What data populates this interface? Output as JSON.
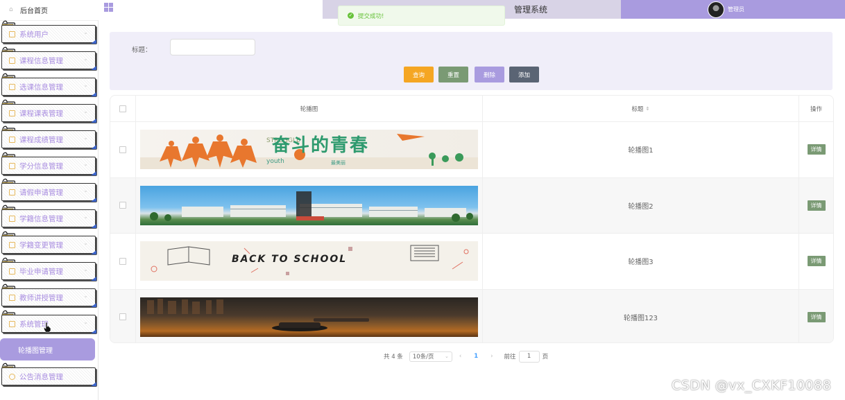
{
  "sidebar": {
    "home_label": "后台首页",
    "items": [
      {
        "label": "系统用户",
        "icon": "user-icon"
      },
      {
        "label": "课程信息管理",
        "icon": "doc-icon"
      },
      {
        "label": "选课信息管理",
        "icon": "doc-icon"
      },
      {
        "label": "课程课表管理",
        "icon": "doc-icon"
      },
      {
        "label": "课程成绩管理",
        "icon": "doc-icon"
      },
      {
        "label": "学分信息管理",
        "icon": "doc-icon"
      },
      {
        "label": "请假申请管理",
        "icon": "doc-icon"
      },
      {
        "label": "学籍信息管理",
        "icon": "doc-icon"
      },
      {
        "label": "学籍变更管理",
        "icon": "doc-icon"
      },
      {
        "label": "毕业申请管理",
        "icon": "doc-icon"
      },
      {
        "label": "教师讲授管理",
        "icon": "doc-icon"
      },
      {
        "label": "系统管理",
        "icon": "doc-icon"
      }
    ],
    "active_sub": "轮播图管理",
    "last_item": {
      "label": "公告消息管理",
      "icon": "info-icon"
    }
  },
  "header": {
    "title": "管理系统",
    "user": "管理员"
  },
  "toast": {
    "message": "提交成功!"
  },
  "search": {
    "label": "标题：",
    "value": "",
    "buttons": {
      "query": "查询",
      "reset": "重置",
      "delete": "删除",
      "add": "添加"
    }
  },
  "table": {
    "headers": {
      "image": "轮播图",
      "title": "标题",
      "actions": "操作"
    },
    "rows": [
      {
        "title": "轮播图1",
        "action": "详情"
      },
      {
        "title": "轮播图2",
        "action": "详情"
      },
      {
        "title": "轮播图3",
        "action": "详情"
      },
      {
        "title": "轮播图123",
        "action": "详情"
      }
    ],
    "banner_texts": {
      "row1": "奋斗的青春",
      "row3": "BACK TO SCHOOL"
    }
  },
  "pagination": {
    "total": "共 4 条",
    "page_size": "10条/页",
    "current": "1",
    "goto_label": "前往",
    "goto_value": "1",
    "page_suffix": "页"
  },
  "watermark": "CSDN @vx_CXKF10088",
  "colors": {
    "accent": "#a99bdf",
    "query": "#f5a623",
    "reset": "#7a9a74",
    "delete": "#a99bdf",
    "add": "#5a6474",
    "toast_bg": "#f0f9eb"
  }
}
